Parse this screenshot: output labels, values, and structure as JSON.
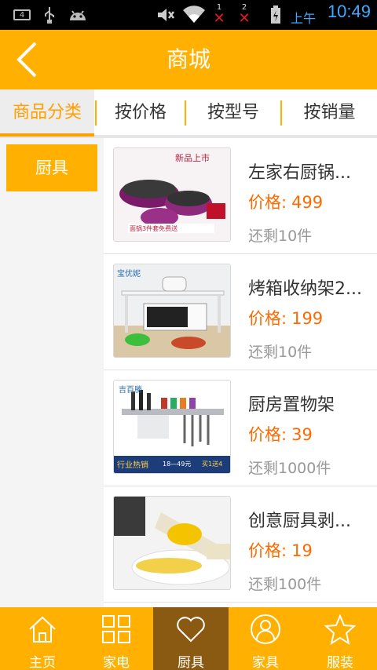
{
  "status_bar": {
    "notif_badge": "4",
    "sim1_label": "1",
    "sim2_label": "2",
    "ampm": "上午",
    "time": "10:49"
  },
  "header": {
    "title": "商城"
  },
  "tabs": [
    {
      "label": "商品分类",
      "active": true
    },
    {
      "label": "按价格",
      "active": false
    },
    {
      "label": "按型号",
      "active": false
    },
    {
      "label": "按销量",
      "active": false
    }
  ],
  "sidebar": {
    "items": [
      {
        "label": "厨具",
        "selected": true
      }
    ]
  },
  "products": [
    {
      "name": "左家右厨锅...",
      "price_label": "价格:",
      "price": "499",
      "stock": "还剩10件",
      "image_texts": {
        "main": "新品上市",
        "sub": "面锅3件套免费送"
      }
    },
    {
      "name": "烤箱收纳架2...",
      "price_label": "价格:",
      "price": "199",
      "stock": "还剩10件",
      "image_texts": {
        "brand": "宝优妮"
      }
    },
    {
      "name": "厨房置物架",
      "price_label": "价格:",
      "price": "39",
      "stock": "还剩1000件",
      "image_texts": {
        "brand": "吉百勝",
        "promo": "行业热销",
        "range": "18—49元",
        "deal": "买1送4"
      }
    },
    {
      "name": "创意厨具剥...",
      "price_label": "价格:",
      "price": "19",
      "stock": "还剩100件",
      "image_texts": {}
    }
  ],
  "bottom_nav": [
    {
      "label": "主页",
      "icon": "home-icon",
      "active": false
    },
    {
      "label": "家电",
      "icon": "grid-icon",
      "active": false
    },
    {
      "label": "厨具",
      "icon": "heart-icon",
      "active": true
    },
    {
      "label": "家具",
      "icon": "person-icon",
      "active": false
    },
    {
      "label": "服装",
      "icon": "star-icon",
      "active": false
    }
  ],
  "colors": {
    "brand": "#ffb000",
    "accent": "#ffa000",
    "price": "#ff6a00",
    "nav_active": "#8a5a12",
    "status_time": "#3fa9ff"
  }
}
